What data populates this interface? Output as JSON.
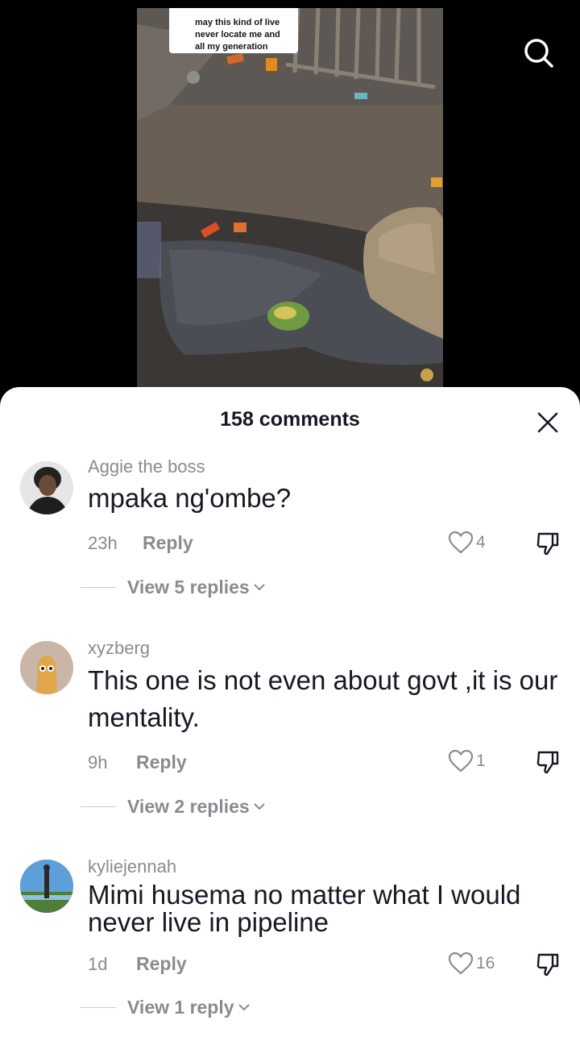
{
  "video": {
    "caption_lines": "may this kind of live\nnever locate me and\nall my generation"
  },
  "icons": {
    "search": "search-icon",
    "close": "close-icon",
    "like": "heart-outline-icon",
    "dislike": "thumbs-down-icon",
    "chevron": "chevron-down-icon"
  },
  "sheet": {
    "title": "158 comments"
  },
  "comments": [
    {
      "username": "Aggie the boss",
      "text": "mpaka ng'ombe?",
      "time": "23h",
      "reply_label": "Reply",
      "likes": "4",
      "view_replies": "View 5 replies"
    },
    {
      "username": "xyzberg",
      "text": "This one is not even about govt ,it is our mentality.",
      "time": "9h",
      "reply_label": "Reply",
      "likes": "1",
      "view_replies": "View 2 replies"
    },
    {
      "username": "kyliejennah",
      "text": "Mimi husema no matter what I would never live in pipeline",
      "time": "1d",
      "reply_label": "Reply",
      "likes": "16",
      "view_replies": "View 1 reply"
    }
  ],
  "colors": {
    "text_primary": "#161823",
    "text_secondary": "#8a8b91",
    "sheet_bg": "#ffffff",
    "backdrop": "#000000"
  }
}
